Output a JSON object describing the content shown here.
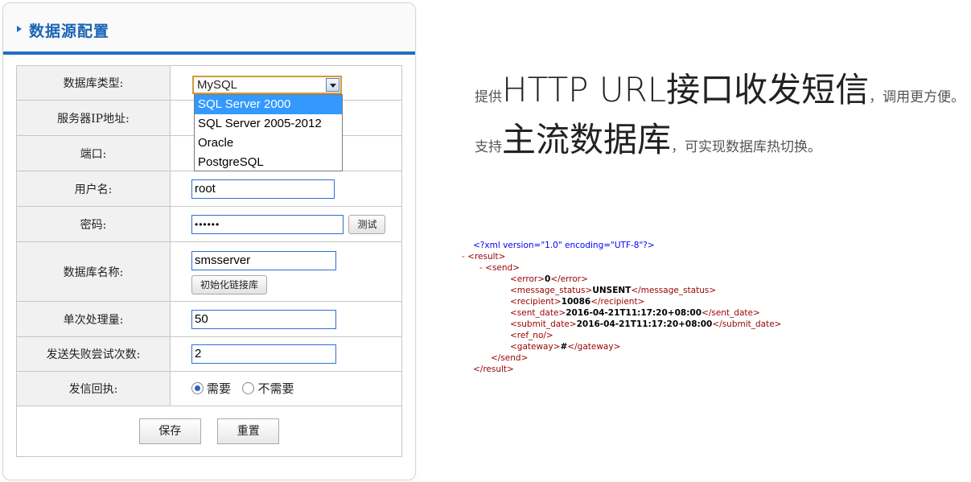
{
  "panel": {
    "title": "数据源配置"
  },
  "form": {
    "db_type": {
      "label": "数据库类型:",
      "value": "MySQL",
      "options": [
        "SQL Server 2000",
        "SQL Server 2005-2012",
        "Oracle",
        "PostgreSQL"
      ],
      "highlighted_option": "SQL Server 2000"
    },
    "server_ip": {
      "label": "服务器IP地址:"
    },
    "port": {
      "label": "端口:"
    },
    "username": {
      "label": "用户名:",
      "value": "root"
    },
    "password": {
      "label": "密码:",
      "value": "••••••",
      "test_button": "测试"
    },
    "db_name": {
      "label": "数据库名称:",
      "value": "smsserver",
      "init_button": "初始化链接库"
    },
    "batch_size": {
      "label": "单次处理量:",
      "value": "50"
    },
    "retry_count": {
      "label": "发送失败尝试次数:",
      "value": "2"
    },
    "receipt": {
      "label": "发信回执:",
      "option_yes": "需要",
      "option_no": "不需要",
      "selected": "需要"
    },
    "save_button": "保存",
    "reset_button": "重置"
  },
  "slogans": {
    "line1": {
      "prefix": "提供",
      "big": "HTTP URL接口收发短信",
      "suffix": "，调用更方便。"
    },
    "line2": {
      "prefix": "支持",
      "big": "主流数据库",
      "suffix": "，可实现数据库热切换。"
    }
  },
  "xml": {
    "declaration": "<?xml version=\"1.0\" encoding=\"UTF-8\"?>",
    "result_open": "<result>",
    "send_open": "<send>",
    "fields": [
      {
        "open": "<error>",
        "value": "0",
        "close": "</error>"
      },
      {
        "open": "<message_status>",
        "value": "UNSENT",
        "close": "</message_status>"
      },
      {
        "open": "<recipient>",
        "value": "10086",
        "close": "</recipient>"
      },
      {
        "open": "<sent_date>",
        "value": "2016-04-21T11:17:20+08:00",
        "close": "</sent_date>"
      },
      {
        "open": "<submit_date>",
        "value": "2016-04-21T11:17:20+08:00",
        "close": "</submit_date>"
      },
      {
        "open": "<ref_no/>",
        "value": "",
        "close": ""
      },
      {
        "open": "<gateway>",
        "value": "#",
        "close": "</gateway>"
      }
    ],
    "send_close": "</send>",
    "result_close": "</result>"
  }
}
